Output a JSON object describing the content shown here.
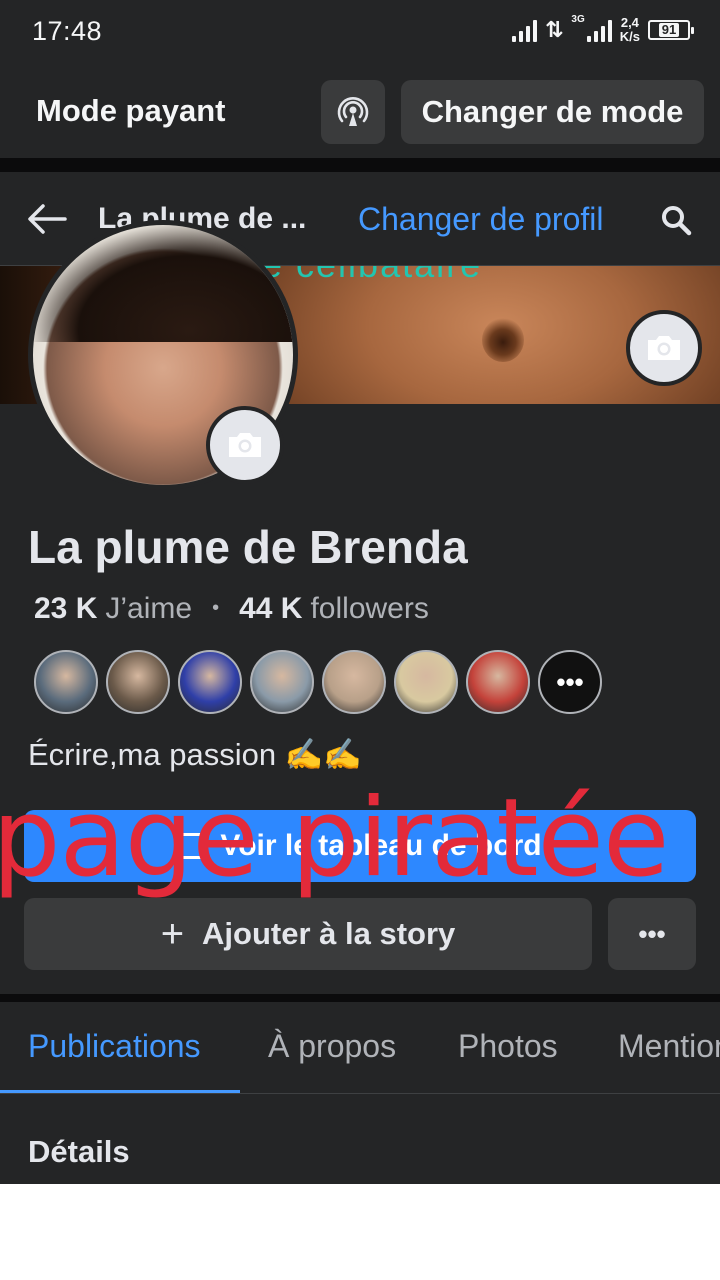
{
  "status_bar": {
    "time": "17:48",
    "network_type": "3G",
    "speed_value": "2,4",
    "speed_unit": "K/s",
    "battery": "91"
  },
  "mode_bar": {
    "label": "Mode payant",
    "icon": "broadcast-icon",
    "switch_button": "Changer de mode"
  },
  "nav": {
    "title": "La plume de ...",
    "switch_profile": "Changer de profil",
    "back_icon": "back-arrow-icon",
    "search_icon": "search-icon"
  },
  "cover": {
    "overlay_text": "e célibataire"
  },
  "profile": {
    "name": "La plume de Brenda",
    "likes_count": "23 K",
    "likes_label": "J’aime",
    "followers_count": "44 K",
    "followers_label": "followers",
    "bio": "Écrire,ma passion ✍️✍️",
    "follower_avatar_colors": [
      "#5a6b7c",
      "#6b5a4a",
      "#2f3fa8",
      "#8a9aa8",
      "#b8a089",
      "#d8c9a0",
      "#c4423a"
    ],
    "more_followers": "•••"
  },
  "buttons": {
    "dashboard": "Voir le tableau de bord",
    "add_story": "Ajouter à la story",
    "more": "•••"
  },
  "watermark": "page piratée",
  "tabs": [
    {
      "label": "Publications",
      "active": true
    },
    {
      "label": "À propos",
      "active": false
    },
    {
      "label": "Photos",
      "active": false
    },
    {
      "label": "Mentions",
      "active": false
    }
  ],
  "details": {
    "title": "Détails"
  },
  "colors": {
    "accent": "#4599ff",
    "primary_button": "#2d88ff",
    "surface": "#242526",
    "watermark": "#e32a3a"
  }
}
